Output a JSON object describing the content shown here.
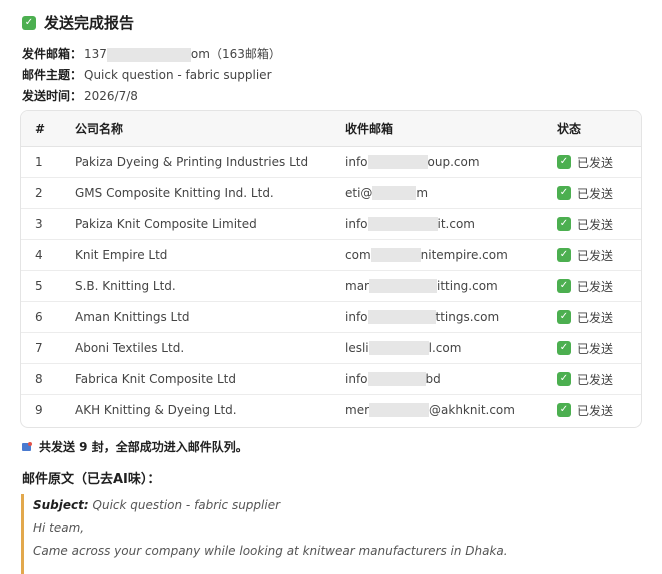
{
  "header": {
    "title": "发送完成报告",
    "check_icon": "check-square-icon"
  },
  "meta": {
    "sender_label": "发件邮箱：",
    "sender_prefix": "137",
    "sender_suffix": "om（163邮箱）",
    "subject_label": "邮件主题：",
    "subject_value": "Quick question - fabric supplier",
    "time_label": "发送时间：",
    "time_value": "2026/7/8"
  },
  "table": {
    "headers": [
      "#",
      "公司名称",
      "收件邮箱",
      "状态"
    ],
    "rows": [
      {
        "num": "1",
        "company": "Pakiza Dyeing & Printing Industries Ltd",
        "email_prefix": "info",
        "email_suffix": "oup.com",
        "status": "已发送"
      },
      {
        "num": "2",
        "company": "GMS Composite Knitting Ind. Ltd.",
        "email_prefix": "eti@",
        "email_suffix": "m",
        "status": "已发送"
      },
      {
        "num": "3",
        "company": "Pakiza Knit Composite Limited",
        "email_prefix": "info",
        "email_suffix": "it.com",
        "status": "已发送"
      },
      {
        "num": "4",
        "company": "Knit Empire Ltd",
        "email_prefix": "com",
        "email_suffix": "nitempire.com",
        "status": "已发送"
      },
      {
        "num": "5",
        "company": "S.B. Knitting Ltd.",
        "email_prefix": "mar",
        "email_suffix": "itting.com",
        "status": "已发送"
      },
      {
        "num": "6",
        "company": "Aman Knittings Ltd",
        "email_prefix": "info",
        "email_suffix": "ttings.com",
        "status": "已发送"
      },
      {
        "num": "7",
        "company": "Aboni Textiles Ltd.",
        "email_prefix": "lesli",
        "email_suffix": "l.com",
        "status": "已发送"
      },
      {
        "num": "8",
        "company": "Fabrica Knit Composite Ltd",
        "email_prefix": "info",
        "email_suffix": "bd",
        "status": "已发送"
      },
      {
        "num": "9",
        "company": "AKH Knitting & Dyeing Ltd.",
        "email_prefix": "mer",
        "email_suffix": "@akhknit.com",
        "status": "已发送"
      }
    ]
  },
  "summary": {
    "icon": "mail-icon",
    "text": "共发送 9 封，全部成功进入邮件队列。"
  },
  "original": {
    "heading": "邮件原文（已去AI味）：",
    "subject_label": "Subject:",
    "subject_value": "Quick question - fabric supplier",
    "line1": "Hi team,",
    "line2": "Came across your company while looking at knitwear manufacturers in Dhaka."
  },
  "colors": {
    "check_green": "#4caf50",
    "quote_border": "#e2a84d"
  }
}
